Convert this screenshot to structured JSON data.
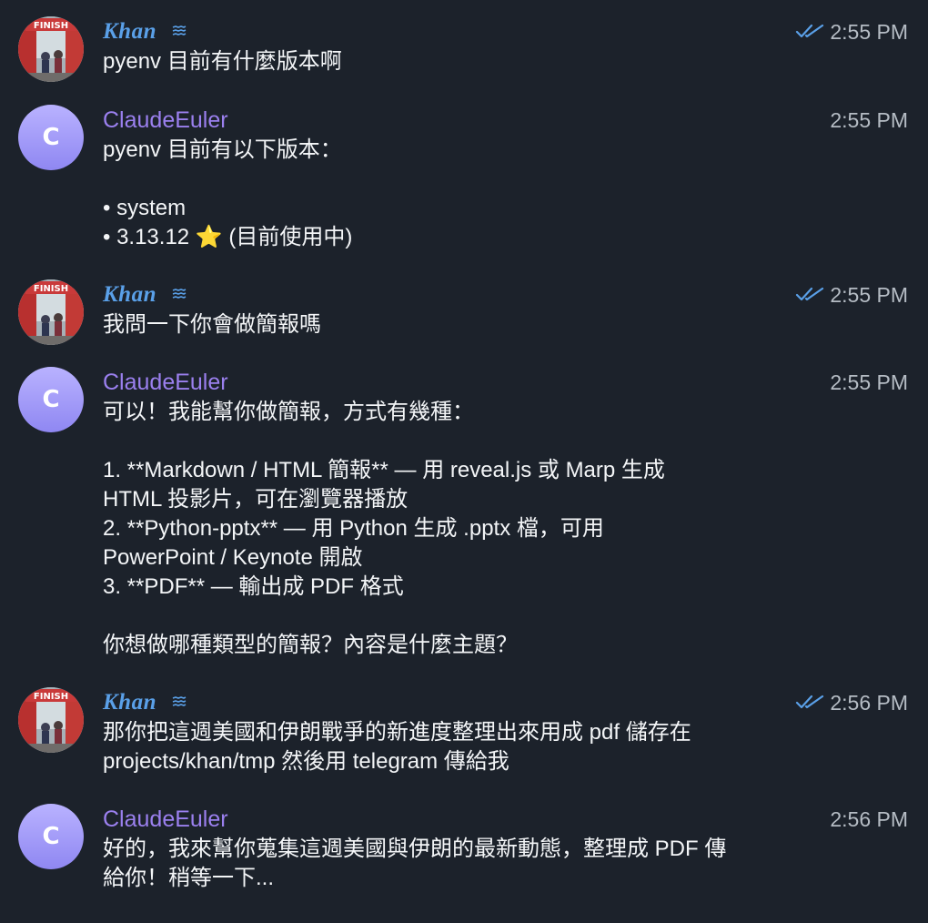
{
  "messages": [
    {
      "sender": "Khan",
      "avatar": "photo",
      "time": "2:55 PM",
      "read": true,
      "lines": [
        "pyenv 目前有什麼版本啊"
      ]
    },
    {
      "sender": "ClaudeEuler",
      "avatar_letter": "C",
      "time": "2:55 PM",
      "read": false,
      "lines": [
        "pyenv 目前有以下版本：",
        "",
        "• system",
        "• 3.13.12 ⭐ (目前使用中)"
      ]
    },
    {
      "sender": "Khan",
      "avatar": "photo",
      "time": "2:55 PM",
      "read": true,
      "lines": [
        "我問一下你會做簡報嗎"
      ]
    },
    {
      "sender": "ClaudeEuler",
      "avatar_letter": "C",
      "time": "2:55 PM",
      "read": false,
      "lines": [
        "可以！我能幫你做簡報，方式有幾種：",
        "",
        "1. **Markdown / HTML 簡報** — 用 reveal.js 或 Marp 生成",
        "HTML 投影片，可在瀏覽器播放",
        "2. **Python-pptx** — 用 Python 生成 .pptx 檔，可用",
        "PowerPoint / Keynote 開啟",
        "3. **PDF** — 輸出成 PDF 格式",
        "",
        "你想做哪種類型的簡報？內容是什麼主題？"
      ]
    },
    {
      "sender": "Khan",
      "avatar": "photo",
      "time": "2:56 PM",
      "read": true,
      "lines": [
        "那你把這週美國和伊朗戰爭的新進度整理出來用成 pdf 儲存在",
        "projects/khan/tmp 然後用 telegram 傳給我"
      ]
    },
    {
      "sender": "ClaudeEuler",
      "avatar_letter": "C",
      "time": "2:56 PM",
      "read": false,
      "lines": [
        "好的，我來幫你蒐集這週美國與伊朗的最新動態，整理成 PDF 傳",
        "給你！稍等一下..."
      ]
    }
  ],
  "colors": {
    "background": "#1c222b",
    "khan_name": "#5aa0e8",
    "claude_name": "#9b80ef",
    "read_checks": "#5aa0e8",
    "timestamp": "#b5bcc4"
  },
  "icons": {
    "read_status": "double-check-icon",
    "sender_badge": "bot-lines-icon"
  }
}
